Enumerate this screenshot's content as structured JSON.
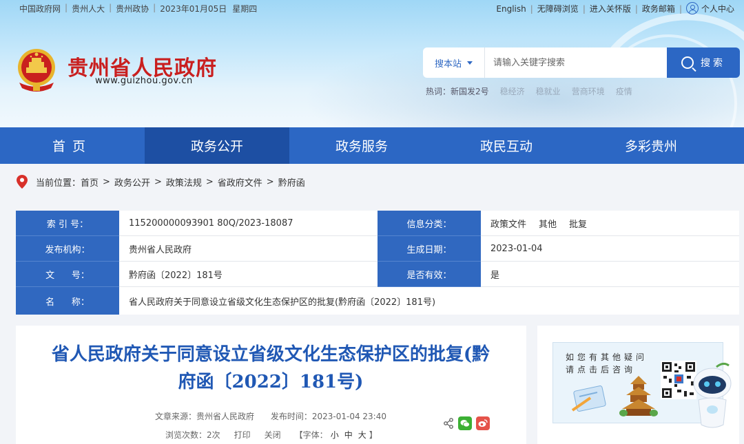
{
  "topbar": {
    "links_left": [
      "中国政府网",
      "贵州人大",
      "贵州政协"
    ],
    "date": "2023年01月05日",
    "weekday": "星期四",
    "links_right": [
      "English",
      "无障碍浏览",
      "进入关怀版",
      "政务邮箱"
    ],
    "user_center": "个人中心"
  },
  "site": {
    "title": "贵州省人民政府",
    "url": "www.guizhou.gov.cn"
  },
  "search": {
    "scope": "搜本站",
    "placeholder": "请输入关键字搜索",
    "button": "搜索",
    "hot_label": "热词：",
    "hot_words": [
      "新国发2号",
      "稳经济",
      "稳就业",
      "营商环境",
      "疫情"
    ]
  },
  "nav": {
    "items": [
      "首页",
      "政务公开",
      "政务服务",
      "政民互动",
      "多彩贵州"
    ],
    "active": "政务公开"
  },
  "breadcrumb": {
    "label": "当前位置：",
    "items": [
      "首页",
      "政务公开",
      "政策法规",
      "省政府文件",
      "黔府函"
    ]
  },
  "info": {
    "index_label": "索 引 号：",
    "index_value": "115200000093901 80Q/2023-18087",
    "category_label": "信息分类：",
    "category_values": [
      "政策文件",
      "其他",
      "批复"
    ],
    "publisher_label": "发布机构：",
    "publisher_value": "贵州省人民政府",
    "date_label": "生成日期：",
    "date_value": "2023-01-04",
    "docno_label": "文      号：",
    "docno_value": "黔府函〔2022〕181号",
    "valid_label": "是否有效：",
    "valid_value": "是",
    "name_label": "名      称：",
    "name_value": "省人民政府关于同意设立省级文化生态保护区的批复(黔府函〔2022〕181号)"
  },
  "article": {
    "title": "省人民政府关于同意设立省级文化生态保护区的批复(黔府函〔2022〕181号)",
    "source": "文章来源：贵州省人民政府",
    "published": "发布时间：2023-01-04 23:40",
    "views": "浏览次数：2次",
    "print": "打印",
    "close": "关闭",
    "font_label": "【字体：",
    "font_small": "小",
    "font_medium": "中",
    "font_large": "大",
    "font_end": "】"
  },
  "side": {
    "ad_line1": "如您有其他疑问",
    "ad_line2": "请点击后咨询"
  },
  "colors": {
    "primary": "#2c67c4",
    "nav_active": "#1d4fa3",
    "title_red": "#c91f1f",
    "article_title": "#2058b4"
  }
}
